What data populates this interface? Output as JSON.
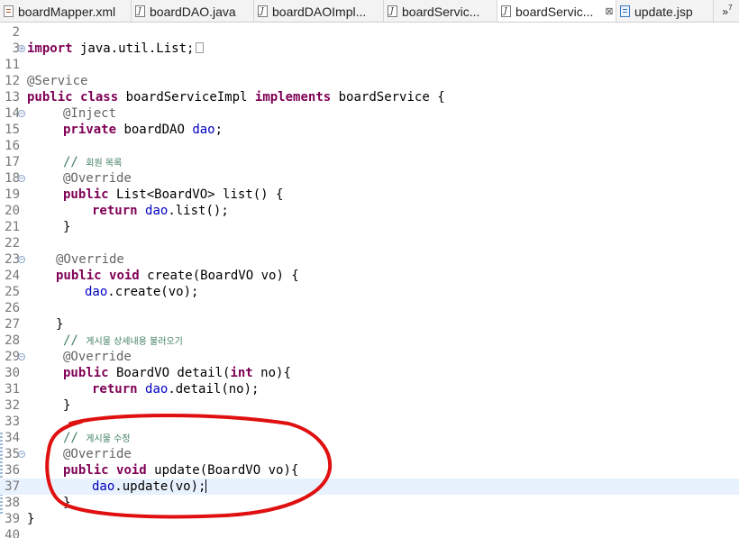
{
  "tabs": [
    {
      "label": "boardMapper.xml",
      "icon": "xml-file-icon",
      "active": false
    },
    {
      "label": "boardDAO.java",
      "icon": "java-file-icon",
      "active": false
    },
    {
      "label": "boardDAOImpl...",
      "icon": "java-file-icon",
      "active": false
    },
    {
      "label": "boardServic...",
      "icon": "java-file-icon",
      "active": false
    },
    {
      "label": "boardServic...",
      "icon": "java-file-icon",
      "active": true
    },
    {
      "label": "update.jsp",
      "icon": "jsp-file-icon",
      "active": false
    }
  ],
  "tab_close_glyph": "⊠",
  "overflow": {
    "glyph": "»",
    "count": "7"
  },
  "editor": {
    "line_numbers": [
      "2",
      "3",
      "11",
      "12",
      "13",
      "14",
      "15",
      "16",
      "17",
      "18",
      "19",
      "20",
      "21",
      "22",
      "23",
      "24",
      "25",
      "26",
      "27",
      "28",
      "29",
      "30",
      "31",
      "32",
      "33",
      "34",
      "35",
      "36",
      "37",
      "38",
      "39",
      "40"
    ],
    "l3": {
      "kw": "import",
      "rest": " java.util.List;"
    },
    "l12": {
      "ann": "@Service"
    },
    "l13": {
      "kw1": "public",
      "kw2": "class",
      "name": " boardServiceImpl ",
      "kw3": "implements",
      "rest": " boardService {"
    },
    "l14": {
      "ann": "@Inject"
    },
    "l15": {
      "kw": "private",
      "type": " boardDAO ",
      "field": "dao",
      "rest": ";"
    },
    "l17": {
      "slash": "// ",
      "text": "회원 목록"
    },
    "l18": {
      "ann": "@Override"
    },
    "l19": {
      "kw": "public",
      "rest": " List<BoardVO> list() {"
    },
    "l20": {
      "kw": "return",
      "field": "dao",
      "rest": ".list();"
    },
    "l21": {
      "rest": "}"
    },
    "l23": {
      "ann": "@Override"
    },
    "l24": {
      "kw1": "public",
      "kw2": "void",
      "rest": " create(BoardVO vo) {"
    },
    "l25": {
      "field": "dao",
      "rest1": ".create(",
      "param": "vo",
      "rest2": ");"
    },
    "l27": {
      "rest": "}"
    },
    "l28": {
      "slash": "// ",
      "text": "게시물 상세내용 불러오기"
    },
    "l29": {
      "ann": "@Override"
    },
    "l30": {
      "kw1": "public",
      "type": " BoardVO detail(",
      "kw2": "int",
      "param": " no",
      "rest": "){"
    },
    "l31": {
      "kw": "return",
      "field": "dao",
      "rest1": ".detail(",
      "param": "no",
      "rest2": ");"
    },
    "l32": {
      "rest": "}"
    },
    "l34": {
      "slash": "// ",
      "text": "게시물 수정"
    },
    "l35": {
      "ann": "@Override"
    },
    "l36": {
      "kw1": "public",
      "kw2": "void",
      "rest1": " update(BoardVO ",
      "param": "vo",
      "rest2": "){"
    },
    "l37": {
      "field": "dao",
      "rest1": ".update(",
      "param": "vo",
      "rest2": ");"
    },
    "l38": {
      "rest": "}"
    },
    "l39": {
      "rest": "}"
    }
  },
  "colors": {
    "keyword": "#7f0055",
    "annotation": "#646464",
    "field": "#0000c0",
    "comment": "#3f7f5f",
    "current_line": "#e8f2fe",
    "highlight_circle": "#e01010"
  }
}
